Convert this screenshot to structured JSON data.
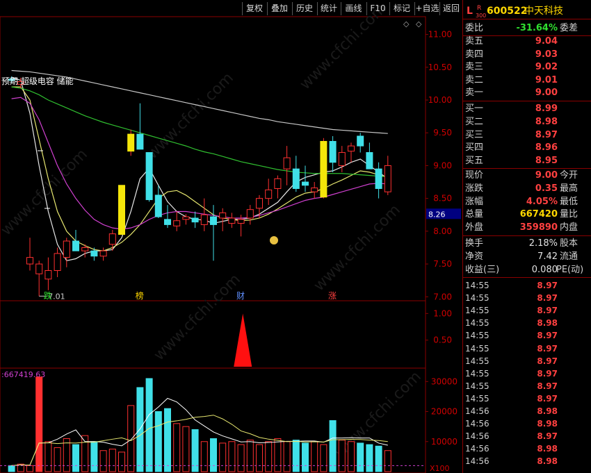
{
  "toolbar": {
    "buttons": [
      "复权",
      "叠加",
      "历史",
      "统计",
      "画线",
      "F10",
      "标记",
      "+自选",
      "返回"
    ]
  },
  "stock": {
    "prefix": "L",
    "code": "600522",
    "name": "中天科技",
    "badge_top": "R",
    "badge_bottom": "300"
  },
  "order_ratio": {
    "label": "委比",
    "value": "-31.64%",
    "label2": "委差"
  },
  "asks": [
    {
      "label": "卖五",
      "price": "9.04"
    },
    {
      "label": "卖四",
      "price": "9.03"
    },
    {
      "label": "卖三",
      "price": "9.02"
    },
    {
      "label": "卖二",
      "price": "9.01"
    },
    {
      "label": "卖一",
      "price": "9.00"
    }
  ],
  "bids": [
    {
      "label": "买一",
      "price": "8.99"
    },
    {
      "label": "买二",
      "price": "8.98"
    },
    {
      "label": "买三",
      "price": "8.97"
    },
    {
      "label": "买四",
      "price": "8.96"
    },
    {
      "label": "买五",
      "price": "8.95"
    }
  ],
  "quote": [
    {
      "label": "现价",
      "value": "9.00",
      "label2": "今开",
      "color": "#ff4040"
    },
    {
      "label": "涨跌",
      "value": "0.35",
      "label2": "最高",
      "color": "#ff4040"
    },
    {
      "label": "涨幅",
      "value": "4.05%",
      "label2": "最低",
      "color": "#ff4040"
    },
    {
      "label": "总量",
      "value": "667420",
      "label2": "量比",
      "color": "#ffd700"
    },
    {
      "label": "外盘",
      "value": "359890",
      "label2": "内盘",
      "color": "#ff4040"
    }
  ],
  "stats": [
    {
      "label": "换手",
      "value": "2.18%",
      "label2": "股本"
    },
    {
      "label": "净资",
      "value": "7.42",
      "label2": "流通"
    },
    {
      "label": "收益(三)",
      "value": "0.080",
      "label2": "PE(动)"
    }
  ],
  "ticks": [
    {
      "time": "14:55",
      "price": "8.97"
    },
    {
      "time": "14:55",
      "price": "8.97"
    },
    {
      "time": "14:55",
      "price": "8.97"
    },
    {
      "time": "14:55",
      "price": "8.98"
    },
    {
      "time": "14:55",
      "price": "8.97"
    },
    {
      "time": "14:55",
      "price": "8.97"
    },
    {
      "time": "14:55",
      "price": "8.97"
    },
    {
      "time": "14:55",
      "price": "8.97"
    },
    {
      "time": "14:55",
      "price": "8.97"
    },
    {
      "time": "14:55",
      "price": "8.97"
    },
    {
      "time": "14:56",
      "price": "8.98"
    },
    {
      "time": "14:56",
      "price": "8.98"
    },
    {
      "time": "14:56",
      "price": "8.97"
    },
    {
      "time": "14:56",
      "price": "8.98"
    },
    {
      "time": "14:56",
      "price": "8.98"
    }
  ],
  "chart_data": [
    {
      "type": "candlestick",
      "price_axis_ticks": [
        "11.00",
        "10.50",
        "10.00",
        "9.50",
        "9.00",
        "8.50",
        "8.00",
        "7.50",
        "7.00"
      ],
      "ylim": [
        6.95,
        11.25
      ],
      "current_price_marker": "8.26",
      "low_label": "7.01",
      "legend_text": "预期 超级电容 储能",
      "event_markers": [
        {
          "index": 4,
          "label": "跌"
        },
        {
          "index": 14,
          "label": "榜"
        },
        {
          "index": 25,
          "label": "财"
        },
        {
          "index": 35,
          "label": "涨"
        }
      ],
      "candles": [
        {
          "o": 10.32,
          "h": 10.36,
          "l": 10.26,
          "c": 10.3
        },
        {
          "o": 10.24,
          "h": 10.34,
          "l": 10.18,
          "c": 10.28
        },
        {
          "o": 7.5,
          "h": 7.9,
          "l": 7.4,
          "c": 7.6
        },
        {
          "o": 7.35,
          "h": 7.55,
          "l": 7.01,
          "c": 7.5
        },
        {
          "o": 7.27,
          "h": 7.6,
          "l": 7.1,
          "c": 7.4
        },
        {
          "o": 7.4,
          "h": 7.75,
          "l": 7.3,
          "c": 7.66
        },
        {
          "o": 7.6,
          "h": 7.9,
          "l": 7.45,
          "c": 7.85
        },
        {
          "o": 7.85,
          "h": 8.02,
          "l": 7.7,
          "c": 7.7
        },
        {
          "o": 7.7,
          "h": 7.8,
          "l": 7.6,
          "c": 7.75
        },
        {
          "o": 7.7,
          "h": 7.75,
          "l": 7.55,
          "c": 7.62
        },
        {
          "o": 7.62,
          "h": 7.75,
          "l": 7.55,
          "c": 7.7
        },
        {
          "o": 7.8,
          "h": 8.02,
          "l": 7.7,
          "c": 7.96
        },
        {
          "o": 7.95,
          "h": 8.7,
          "l": 7.95,
          "c": 8.7
        },
        {
          "o": 9.22,
          "h": 9.55,
          "l": 9.15,
          "c": 9.48
        },
        {
          "o": 9.48,
          "h": 9.95,
          "l": 9.25,
          "c": 9.25
        },
        {
          "o": 9.2,
          "h": 9.0,
          "l": 8.45,
          "c": 8.48
        },
        {
          "o": 8.55,
          "h": 8.7,
          "l": 8.2,
          "c": 8.22
        },
        {
          "o": 8.18,
          "h": 8.4,
          "l": 8.05,
          "c": 8.1
        },
        {
          "o": 8.08,
          "h": 8.3,
          "l": 8.0,
          "c": 8.16
        },
        {
          "o": 8.18,
          "h": 8.26,
          "l": 8.1,
          "c": 8.22
        },
        {
          "o": 8.2,
          "h": 8.3,
          "l": 8.05,
          "c": 8.14
        },
        {
          "o": 8.1,
          "h": 8.5,
          "l": 8.0,
          "c": 8.25
        },
        {
          "o": 8.22,
          "h": 8.4,
          "l": 7.55,
          "c": 8.1
        },
        {
          "o": 8.2,
          "h": 8.35,
          "l": 8.0,
          "c": 8.28
        },
        {
          "o": 8.12,
          "h": 8.28,
          "l": 8.05,
          "c": 8.2
        },
        {
          "o": 8.12,
          "h": 8.25,
          "l": 7.92,
          "c": 8.18
        },
        {
          "o": 8.2,
          "h": 8.4,
          "l": 8.1,
          "c": 8.33
        },
        {
          "o": 8.35,
          "h": 8.55,
          "l": 8.2,
          "c": 8.5
        },
        {
          "o": 8.5,
          "h": 8.8,
          "l": 8.4,
          "c": 8.63
        },
        {
          "o": 8.65,
          "h": 8.85,
          "l": 8.5,
          "c": 8.8
        },
        {
          "o": 8.95,
          "h": 9.3,
          "l": 8.7,
          "c": 9.12
        },
        {
          "o": 8.95,
          "h": 9.15,
          "l": 8.6,
          "c": 8.65
        },
        {
          "o": 8.75,
          "h": 9.0,
          "l": 8.6,
          "c": 8.7
        },
        {
          "o": 8.6,
          "h": 8.75,
          "l": 8.5,
          "c": 8.66
        },
        {
          "o": 8.52,
          "h": 9.42,
          "l": 8.5,
          "c": 9.37
        },
        {
          "o": 9.37,
          "h": 9.45,
          "l": 8.9,
          "c": 9.05
        },
        {
          "o": 9.0,
          "h": 9.3,
          "l": 8.9,
          "c": 9.2
        },
        {
          "o": 9.22,
          "h": 9.35,
          "l": 9.05,
          "c": 9.3
        },
        {
          "o": 9.45,
          "h": 9.5,
          "l": 9.2,
          "c": 9.3
        },
        {
          "o": 9.2,
          "h": 9.35,
          "l": 8.95,
          "c": 8.95
        },
        {
          "o": 8.95,
          "h": 9.05,
          "l": 8.5,
          "c": 8.65
        },
        {
          "o": 8.6,
          "h": 9.15,
          "l": 8.55,
          "c": 9.0
        }
      ],
      "ma_lines": [
        {
          "color": "#e8e8e8",
          "values": [
            10.35,
            10.3,
            9.8,
            9.0,
            8.3,
            7.8,
            7.55,
            7.58,
            7.66,
            7.7,
            7.7,
            7.72,
            7.9,
            8.3,
            8.8,
            8.96,
            8.7,
            8.45,
            8.3,
            8.22,
            8.18,
            8.17,
            8.12,
            8.15,
            8.18,
            8.18,
            8.2,
            8.26,
            8.35,
            8.44,
            8.6,
            8.75,
            8.82,
            8.86,
            8.9,
            8.92,
            8.98,
            9.05,
            9.1,
            9.0,
            8.9,
            8.8
          ]
        },
        {
          "color": "#e8e870",
          "values": [
            10.2,
            10.2,
            10.0,
            9.4,
            8.8,
            8.3,
            8.0,
            7.85,
            7.78,
            7.72,
            7.7,
            7.75,
            7.83,
            7.95,
            8.1,
            8.3,
            8.5,
            8.6,
            8.62,
            8.55,
            8.45,
            8.35,
            8.25,
            8.2,
            8.18,
            8.16,
            8.17,
            8.2,
            8.26,
            8.34,
            8.43,
            8.52,
            8.58,
            8.6,
            8.65,
            8.72,
            8.78,
            8.85,
            8.92,
            8.9,
            8.86,
            8.82
          ]
        },
        {
          "color": "#d040d0",
          "values": [
            10.02,
            10.04,
            9.95,
            9.7,
            9.35,
            9.0,
            8.72,
            8.5,
            8.32,
            8.18,
            8.1,
            8.05,
            8.03,
            8.05,
            8.1,
            8.18,
            8.24,
            8.28,
            8.3,
            8.3,
            8.28,
            8.26,
            8.24,
            8.22,
            8.2,
            8.2,
            8.21,
            8.24,
            8.28,
            8.32,
            8.37,
            8.42,
            8.47,
            8.5,
            8.52,
            8.56,
            8.6,
            8.64,
            8.68,
            8.72,
            8.73,
            8.72
          ]
        },
        {
          "color": "#30c030",
          "values": [
            10.2,
            10.18,
            10.14,
            10.08,
            10.0,
            9.94,
            9.88,
            9.82,
            9.76,
            9.71,
            9.66,
            9.62,
            9.58,
            9.54,
            9.5,
            9.46,
            9.42,
            9.38,
            9.34,
            9.3,
            9.25,
            9.21,
            9.18,
            9.14,
            9.1,
            9.06,
            9.03,
            9.0,
            8.97,
            8.94,
            8.92,
            8.9,
            8.89,
            8.88,
            8.88,
            8.88,
            8.88,
            8.87,
            8.86,
            8.85,
            8.84,
            8.83
          ]
        },
        {
          "color": "#c8c8c8",
          "values": [
            10.45,
            10.44,
            10.43,
            10.41,
            10.39,
            10.37,
            10.35,
            10.32,
            10.29,
            10.26,
            10.23,
            10.2,
            10.17,
            10.14,
            10.11,
            10.08,
            10.05,
            10.02,
            9.99,
            9.96,
            9.93,
            9.9,
            9.87,
            9.84,
            9.81,
            9.78,
            9.75,
            9.72,
            9.7,
            9.67,
            9.65,
            9.63,
            9.61,
            9.59,
            9.57,
            9.55,
            9.54,
            9.53,
            9.52,
            9.51,
            9.5,
            9.49
          ]
        }
      ]
    },
    {
      "type": "signal",
      "axis_ticks": [
        "1.00",
        "0.50"
      ],
      "ylim": [
        0,
        1.2
      ],
      "signals": [
        {
          "index": 22,
          "value": 1.0
        }
      ]
    },
    {
      "type": "bar",
      "title": ":667419.63",
      "axis_ticks": [
        "30000",
        "20000",
        "10000"
      ],
      "axis_unit": "X100",
      "ylim": [
        0,
        34000
      ],
      "values": [
        2000,
        2500,
        2000,
        31500,
        10000,
        8000,
        11000,
        9000,
        12000,
        10000,
        7000,
        7500,
        6500,
        22000,
        28000,
        31000,
        20000,
        21000,
        16000,
        15000,
        14000,
        10000,
        11000,
        9500,
        10000,
        9000,
        10500,
        9000,
        10000,
        11000,
        10000,
        10500,
        9500,
        10000,
        9000,
        17000,
        10500,
        10000,
        9500,
        9000,
        8500,
        7000
      ]
    }
  ]
}
